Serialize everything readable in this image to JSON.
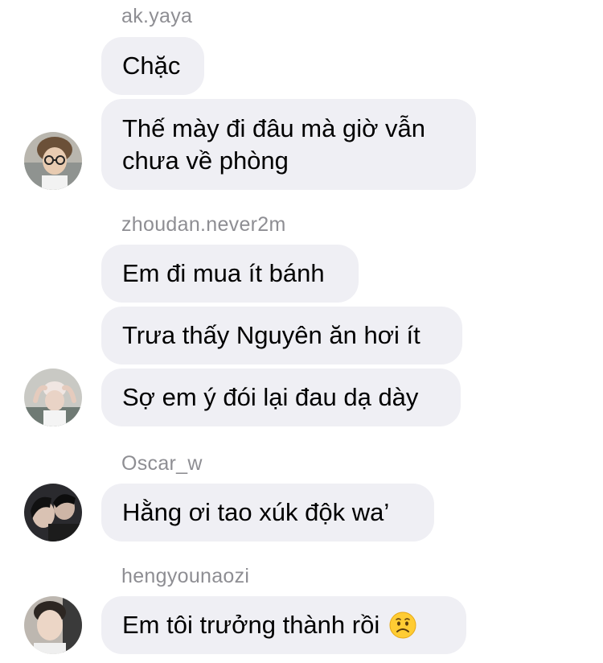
{
  "messages": [
    {
      "username": "ak.yaya",
      "bubbles": [
        "Chặc",
        "Thế mày đi đâu mà giờ vẫn",
        "chưa về phòng"
      ],
      "avatar": "avatar-young-man-glasses"
    },
    {
      "username": "zhoudan.never2m",
      "bubbles": [
        "Em đi mua ít bánh",
        "Trưa thấy Nguyên ăn hơi ít",
        "Sợ em ý đói lại đau dạ dày"
      ],
      "avatar": "avatar-girl-hands-up"
    },
    {
      "username": "Oscar_w",
      "bubbles": [
        "Hằng ơi tao xúk độk wa’"
      ],
      "avatar": "avatar-couple-dark"
    },
    {
      "username": "hengyounaozi",
      "bubbles": [
        "Em tôi trưởng thành rồi"
      ],
      "emoji": "worried-face-icon",
      "avatar": "avatar-young-man-portrait"
    }
  ],
  "colors": {
    "bubble_bg": "#efeff4",
    "username_text": "#8e8e93",
    "message_text": "#000000"
  }
}
